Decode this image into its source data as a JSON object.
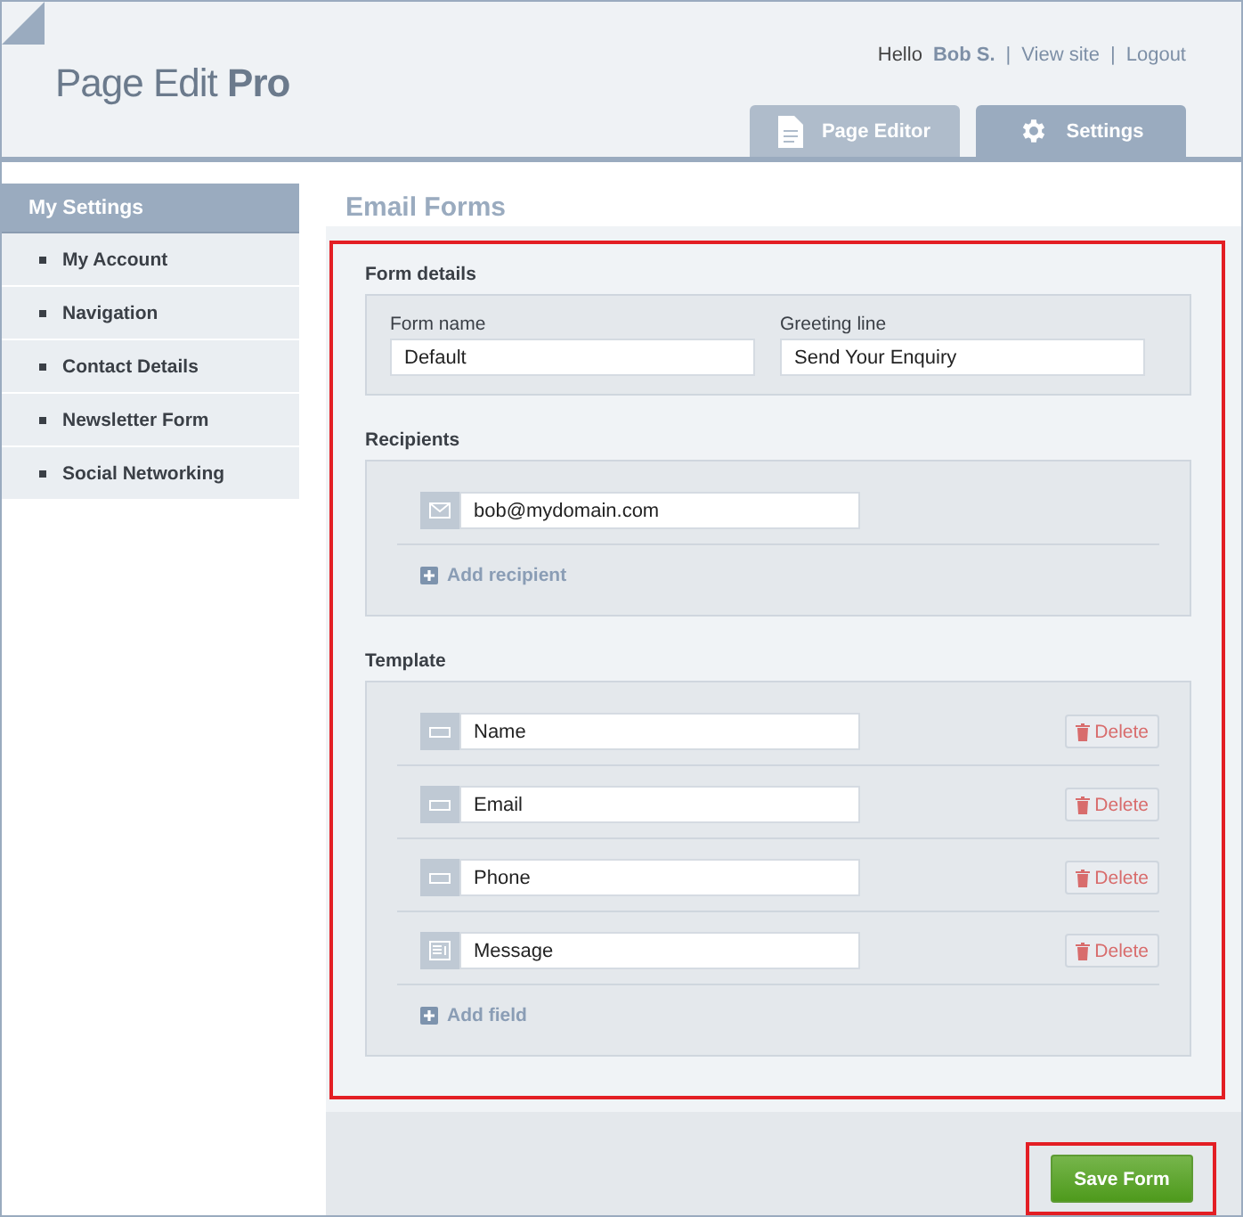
{
  "header": {
    "logo": {
      "light": "Page Edit ",
      "bold": "Pro"
    },
    "greeting": "Hello",
    "user": "Bob S.",
    "separator": "|",
    "links": [
      "View site",
      "Logout"
    ],
    "tabs": [
      {
        "label": "Page Editor",
        "kind": "document",
        "selected": false
      },
      {
        "label": "Settings",
        "kind": "gear",
        "selected": true
      }
    ]
  },
  "sidebar": {
    "title": "My Settings",
    "items": [
      {
        "label": "My Account"
      },
      {
        "label": "Navigation"
      },
      {
        "label": "Contact Details"
      },
      {
        "label": "Newsletter Form"
      },
      {
        "label": "Social Networking"
      }
    ]
  },
  "main": {
    "title": "Email Forms",
    "highlighted": true,
    "form_details": {
      "heading": "Form details",
      "fields": [
        {
          "label": "Form name",
          "value": "Default"
        },
        {
          "label": "Greeting line",
          "value": "Send Your Enquiry"
        }
      ]
    },
    "recipients": {
      "heading": "Recipients",
      "items": [
        {
          "value": "bob@mydomain.com"
        }
      ],
      "add": "Add recipient"
    },
    "template": {
      "heading": "Template",
      "items": [
        {
          "kind": "text",
          "value": "Name",
          "delete": "Delete"
        },
        {
          "kind": "text",
          "value": "Email",
          "delete": "Delete"
        },
        {
          "kind": "text",
          "value": "Phone",
          "delete": "Delete"
        },
        {
          "kind": "textarea",
          "value": "Message",
          "delete": "Delete"
        }
      ],
      "add": "Add field"
    },
    "save": {
      "label": "Save Form",
      "highlighted": true
    }
  }
}
